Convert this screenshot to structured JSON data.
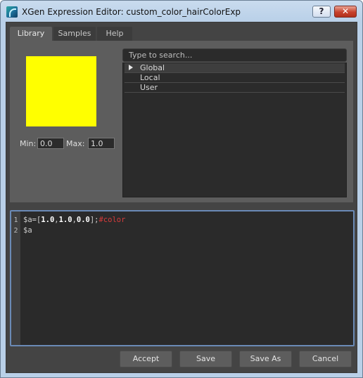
{
  "window": {
    "title": "XGen Expression Editor: custom_color_hairColorExp",
    "help_button": "?",
    "close_button": "✕"
  },
  "tabs": [
    {
      "label": "Library",
      "active": true
    },
    {
      "label": "Samples",
      "active": false
    },
    {
      "label": "Help",
      "active": false
    }
  ],
  "library": {
    "swatch_color": "#ffff00",
    "min_label": "Min:",
    "min_value": "0.0",
    "max_label": "Max:",
    "max_value": "1.0",
    "search_placeholder": "Type to search...",
    "tree_items": [
      "Global",
      "Local",
      "User"
    ]
  },
  "editor": {
    "line_numbers": [
      "1",
      "2"
    ],
    "line1": {
      "prefix": "$a=[",
      "n1": "1.0",
      "c1": ",",
      "n2": "1.0",
      "c2": ",",
      "n3": "0.0",
      "suffix": "];",
      "comment": "#color"
    },
    "line2": "$a"
  },
  "buttons": {
    "accept": "Accept",
    "save": "Save",
    "save_as": "Save As",
    "cancel": "Cancel"
  },
  "colors": {
    "panel": "#444444",
    "active_tab": "#5d5d5d",
    "editor_border": "#6a8ab6",
    "comment": "#d53b3b"
  }
}
